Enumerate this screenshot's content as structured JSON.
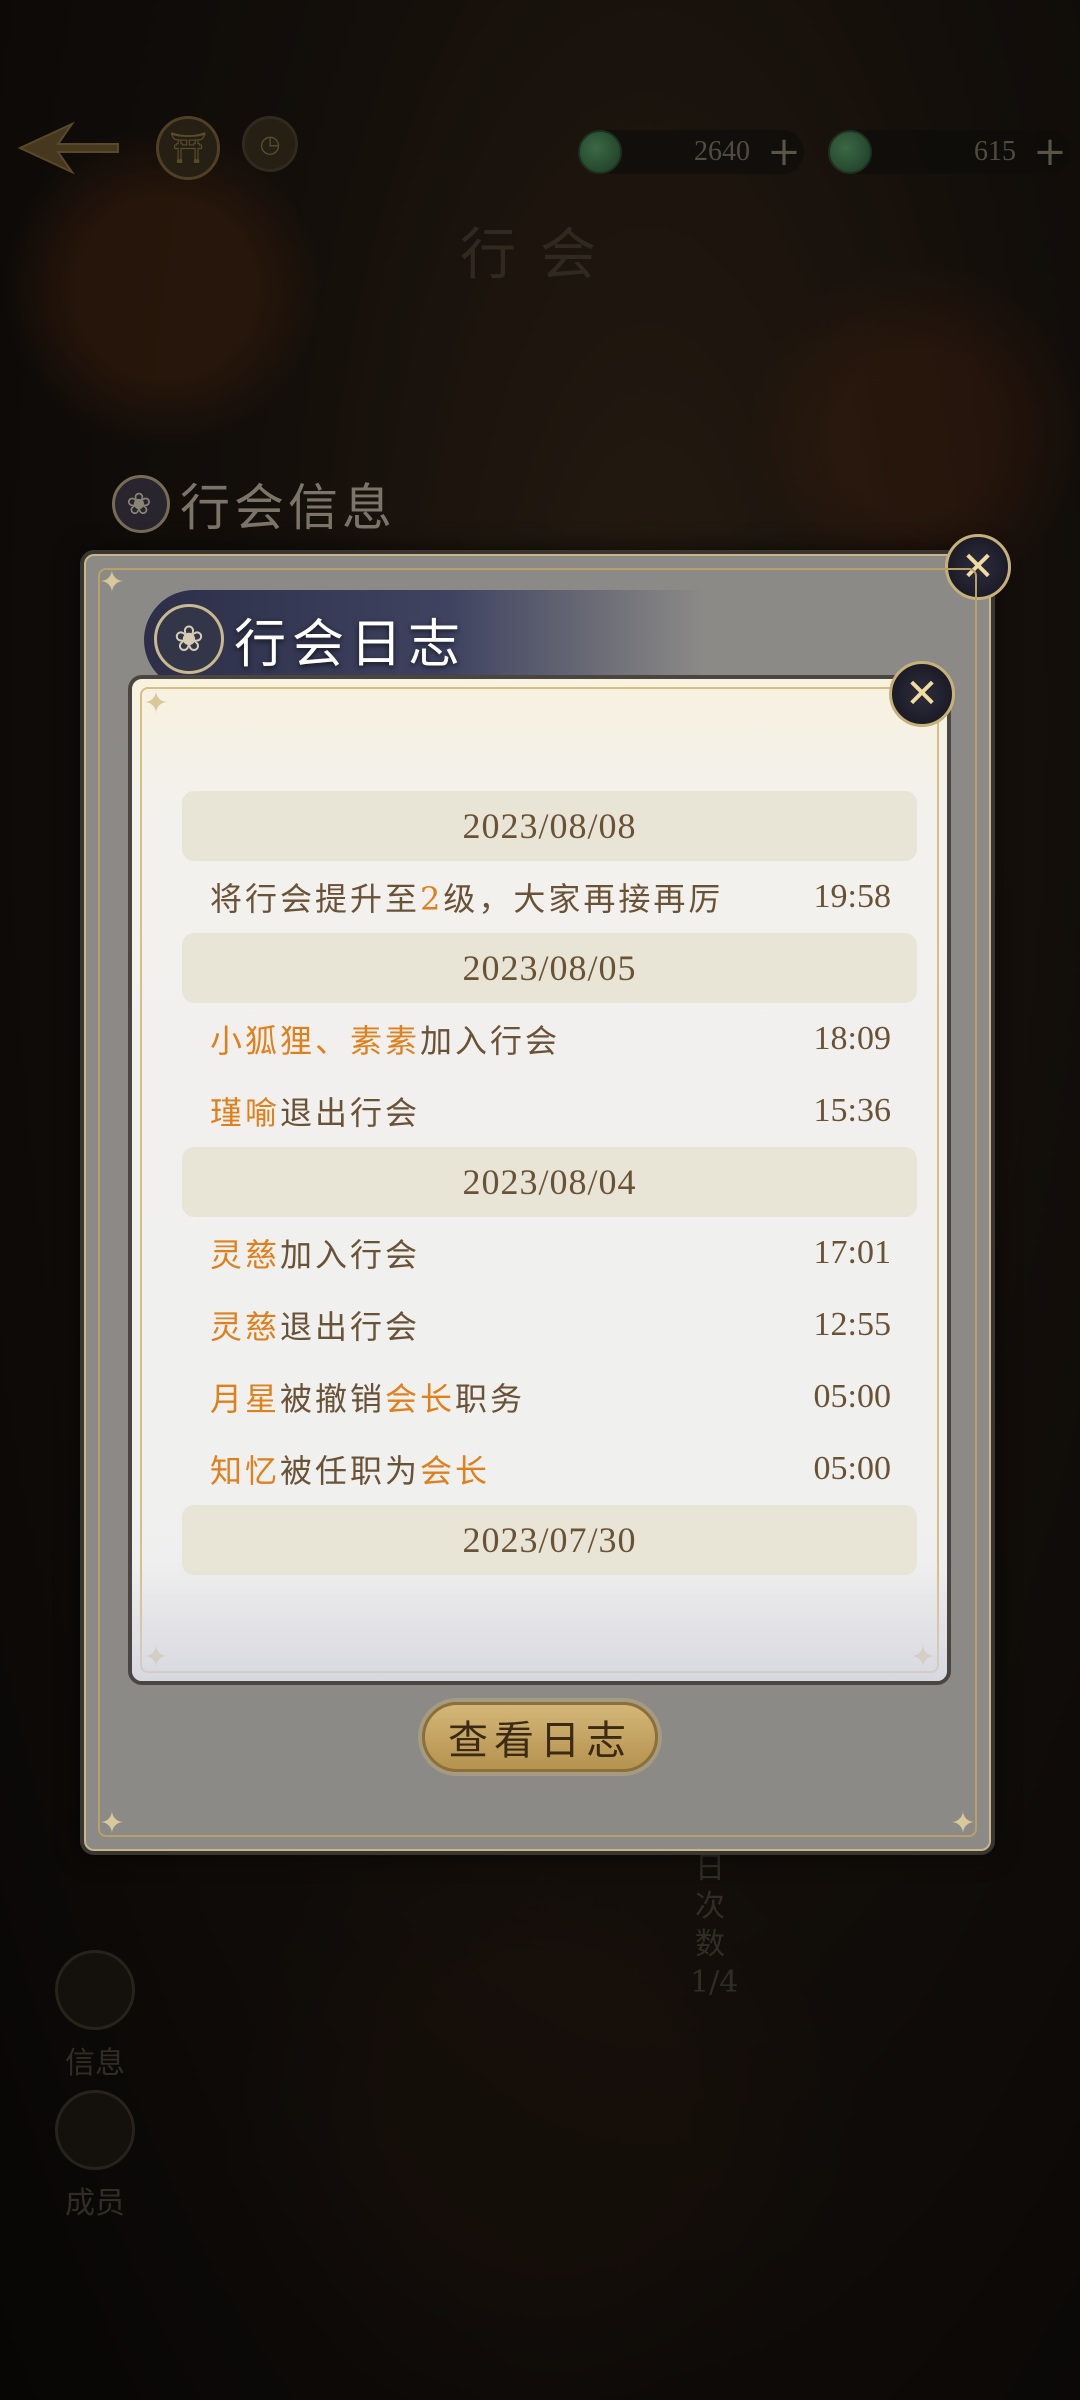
{
  "top_bar": {
    "currencies": [
      {
        "icon": "jade-coin-icon",
        "value": "2640",
        "plus": "+"
      },
      {
        "icon": "green-gem-icon",
        "value": "615",
        "plus": "+"
      }
    ]
  },
  "page_title": "行会",
  "behind_panel_title": "行会信息",
  "side_nav": [
    {
      "label": "信息"
    },
    {
      "label": "成员"
    }
  ],
  "behind_text": "日次数1/4",
  "dialog": {
    "title": "行会日志",
    "close_symbol": "✕",
    "view_log_button": "查看日志"
  },
  "log": {
    "groups": [
      {
        "date": "2023/08/08",
        "entries": [
          {
            "parts": [
              {
                "t": "将行会提升至",
                "hl": false
              },
              {
                "t": "2",
                "hl": true
              },
              {
                "t": "级，大家再接再厉",
                "hl": false
              }
            ],
            "time": "19:58"
          }
        ]
      },
      {
        "date": "2023/08/05",
        "entries": [
          {
            "parts": [
              {
                "t": "小狐狸、素素",
                "hl": true
              },
              {
                "t": "加入行会",
                "hl": false
              }
            ],
            "time": "18:09"
          },
          {
            "parts": [
              {
                "t": "瑾喻",
                "hl": true
              },
              {
                "t": "退出行会",
                "hl": false
              }
            ],
            "time": "15:36"
          }
        ]
      },
      {
        "date": "2023/08/04",
        "entries": [
          {
            "parts": [
              {
                "t": "灵慈",
                "hl": true
              },
              {
                "t": "加入行会",
                "hl": false
              }
            ],
            "time": "17:01"
          },
          {
            "parts": [
              {
                "t": "灵慈",
                "hl": true
              },
              {
                "t": "退出行会",
                "hl": false
              }
            ],
            "time": "12:55"
          },
          {
            "parts": [
              {
                "t": "月星",
                "hl": true
              },
              {
                "t": "被撤销",
                "hl": false
              },
              {
                "t": "会长",
                "hl": true
              },
              {
                "t": "职务",
                "hl": false
              }
            ],
            "time": "05:00"
          },
          {
            "parts": [
              {
                "t": "知忆",
                "hl": true
              },
              {
                "t": "被任职为",
                "hl": false
              },
              {
                "t": "会长",
                "hl": true
              }
            ],
            "time": "05:00"
          }
        ]
      },
      {
        "date": "2023/07/30",
        "entries": []
      }
    ]
  },
  "colors": {
    "highlight": "#e0801c",
    "text": "#6a5236",
    "date_band": "#e9e5d6"
  }
}
